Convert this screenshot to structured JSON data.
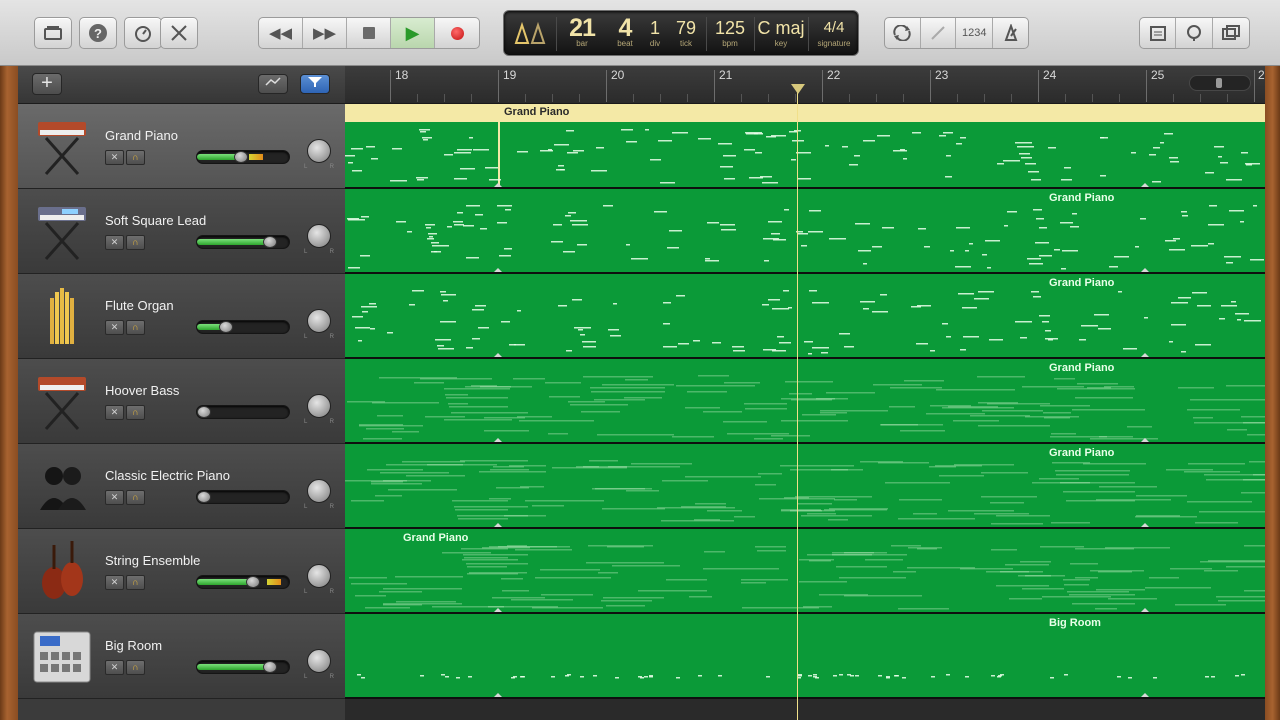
{
  "toolbar": {
    "left_buttons": [
      "library-icon",
      "help-icon",
      "smart-controls-icon",
      "editors-icon"
    ],
    "transport": {
      "rewind": "◀◀",
      "forward": "▶▶",
      "play": "▶"
    },
    "lcd": {
      "bar": "21",
      "bar_label": "bar",
      "beat": "4",
      "beat_label": "beat",
      "div": "1",
      "div_label": "div",
      "tick": "79",
      "tick_label": "tick",
      "bpm": "125",
      "bpm_label": "bpm",
      "key": "C maj",
      "key_label": "key",
      "signature": "4/4",
      "signature_label": "signature"
    },
    "count_in": "1234"
  },
  "ruler": {
    "bars": [
      "18",
      "19",
      "20",
      "21",
      "22",
      "23",
      "24",
      "25",
      "2"
    ]
  },
  "tracks": [
    {
      "name": "Grand Piano",
      "icon": "keyboard-stand-icon",
      "volume": 0.48,
      "selected": true
    },
    {
      "name": "Soft Square Lead",
      "icon": "synth-stand-icon",
      "volume": 0.85,
      "selected": false
    },
    {
      "name": "Flute Organ",
      "icon": "organ-pipes-icon",
      "volume": 0.28,
      "selected": false
    },
    {
      "name": "Hoover Bass",
      "icon": "keyboard-stand-icon",
      "volume": 0.0,
      "selected": false
    },
    {
      "name": "Classic Electric Piano",
      "icon": "band-silhouette-icon",
      "volume": 0.0,
      "selected": false
    },
    {
      "name": "String Ensemble",
      "icon": "string-instruments-icon",
      "volume": 0.63,
      "selected": false
    },
    {
      "name": "Big Room",
      "icon": "drum-machine-icon",
      "volume": 0.85,
      "selected": false
    }
  ],
  "regions": [
    {
      "label": "Grand Piano"
    },
    {
      "label": "Grand Piano"
    },
    {
      "label": "Grand Piano"
    },
    {
      "label": "Grand Piano"
    },
    {
      "label": "Grand Piano"
    },
    {
      "label": "Grand Piano"
    },
    {
      "label": "Big Room"
    }
  ],
  "pan_labels": {
    "l": "L",
    "r": "R"
  },
  "colors": {
    "region_green": "#0b9a38",
    "region_header": "#f4e9a6",
    "lcd_text": "#f1e3a8",
    "playhead": "#f1e08a"
  }
}
